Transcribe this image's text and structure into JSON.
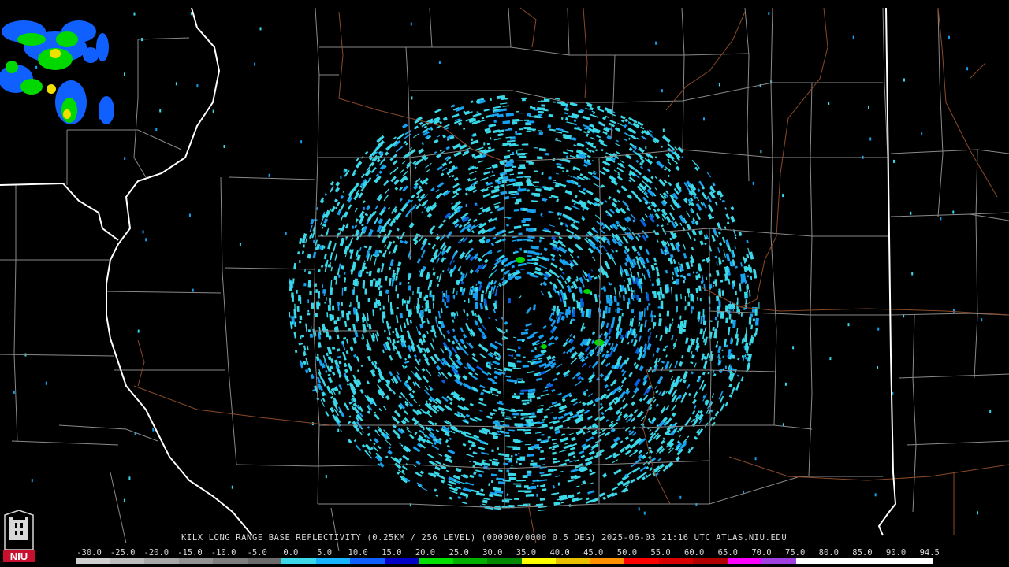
{
  "product": {
    "caption": "KILX LONG RANGE BASE REFLECTIVITY (0.25KM / 256 LEVEL) (000000/0000 0.5 DEG) 2025-06-03 21:16 UTC  ATLAS.NIU.EDU",
    "logo_text": "NIU"
  },
  "scale": {
    "labels": [
      "-30.0",
      "-25.0",
      "-20.0",
      "-15.0",
      "-10.0",
      "-5.0",
      "0.0",
      "5.0",
      "10.0",
      "15.0",
      "20.0",
      "25.0",
      "30.0",
      "35.0",
      "40.0",
      "45.0",
      "50.0",
      "55.0",
      "60.0",
      "65.0",
      "70.0",
      "75.0",
      "80.0",
      "85.0",
      "90.0",
      "94.5"
    ],
    "colors": [
      "#cfcfcf",
      "#bdbdbd",
      "#a8a8a8",
      "#939393",
      "#7e7e7e",
      "#6c6c6c",
      "#3ad8e8",
      "#17b4ff",
      "#1060ff",
      "#0000c8",
      "#00e000",
      "#00b000",
      "#008800",
      "#ffff00",
      "#e8c000",
      "#ff9000",
      "#ff0000",
      "#d80000",
      "#b00000",
      "#ff00ff",
      "#a040e0",
      "#ffffff",
      "#ffffff",
      "#ffffff",
      "#ffffff"
    ]
  },
  "colors": {
    "background": "#000000",
    "county_lines": "#8a8a8a",
    "state_lines": "#ffffff",
    "highways": "#8b4a2a",
    "echo_light": "#3ad8e8",
    "echo_medium": "#17a0f0",
    "echo_strong": "#0a5fe0",
    "storm_green": "#00d800",
    "storm_yellow": "#f0e000",
    "storm_blue": "#1060ff"
  },
  "radar": {
    "site": "KILX"
  }
}
